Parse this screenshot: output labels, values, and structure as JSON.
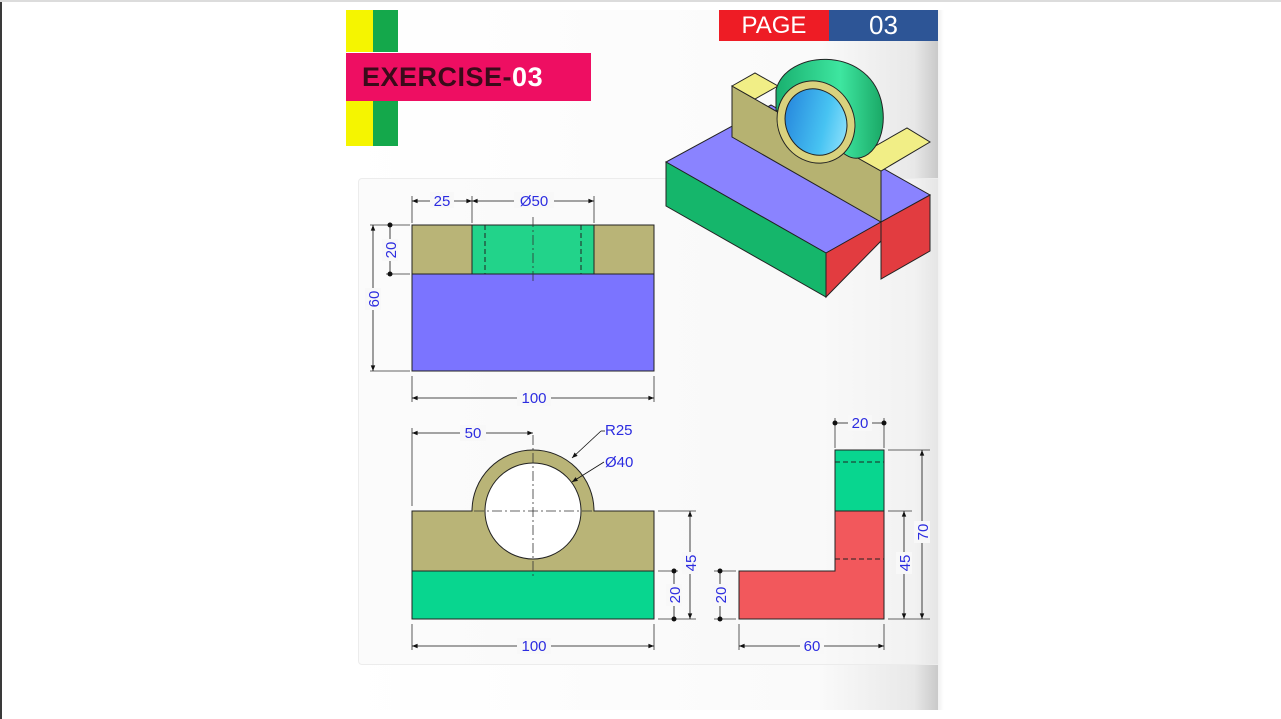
{
  "header": {
    "exercise_prefix": "EXERCISE-",
    "exercise_number": "03",
    "page_label": "PAGE",
    "page_number": "03"
  },
  "colors": {
    "title_bg": "#ee0e62",
    "page_label_bg": "#ee1c25",
    "page_number_bg": "#2d5596",
    "accent_yellow": "#f5f500",
    "accent_green": "#14a84b",
    "part_khaki": "#b9b477",
    "part_teal": "#22d38a",
    "part_blue": "#7b74ff",
    "part_red": "#f2585c",
    "dimension_text": "#2c2ce0"
  },
  "dimensions": {
    "top_view": {
      "width_25": "25",
      "diameter_50": "Ø50",
      "height_20": "20",
      "depth_60": "60",
      "width_100": "100"
    },
    "front_view": {
      "offset_50": "50",
      "radius_25": "R25",
      "diameter_40": "Ø40",
      "height_45": "45",
      "height_20": "20",
      "width_100": "100"
    },
    "side_view": {
      "width_20": "20",
      "height_70": "70",
      "height_45": "45",
      "height_20": "20",
      "depth_60": "60"
    }
  }
}
